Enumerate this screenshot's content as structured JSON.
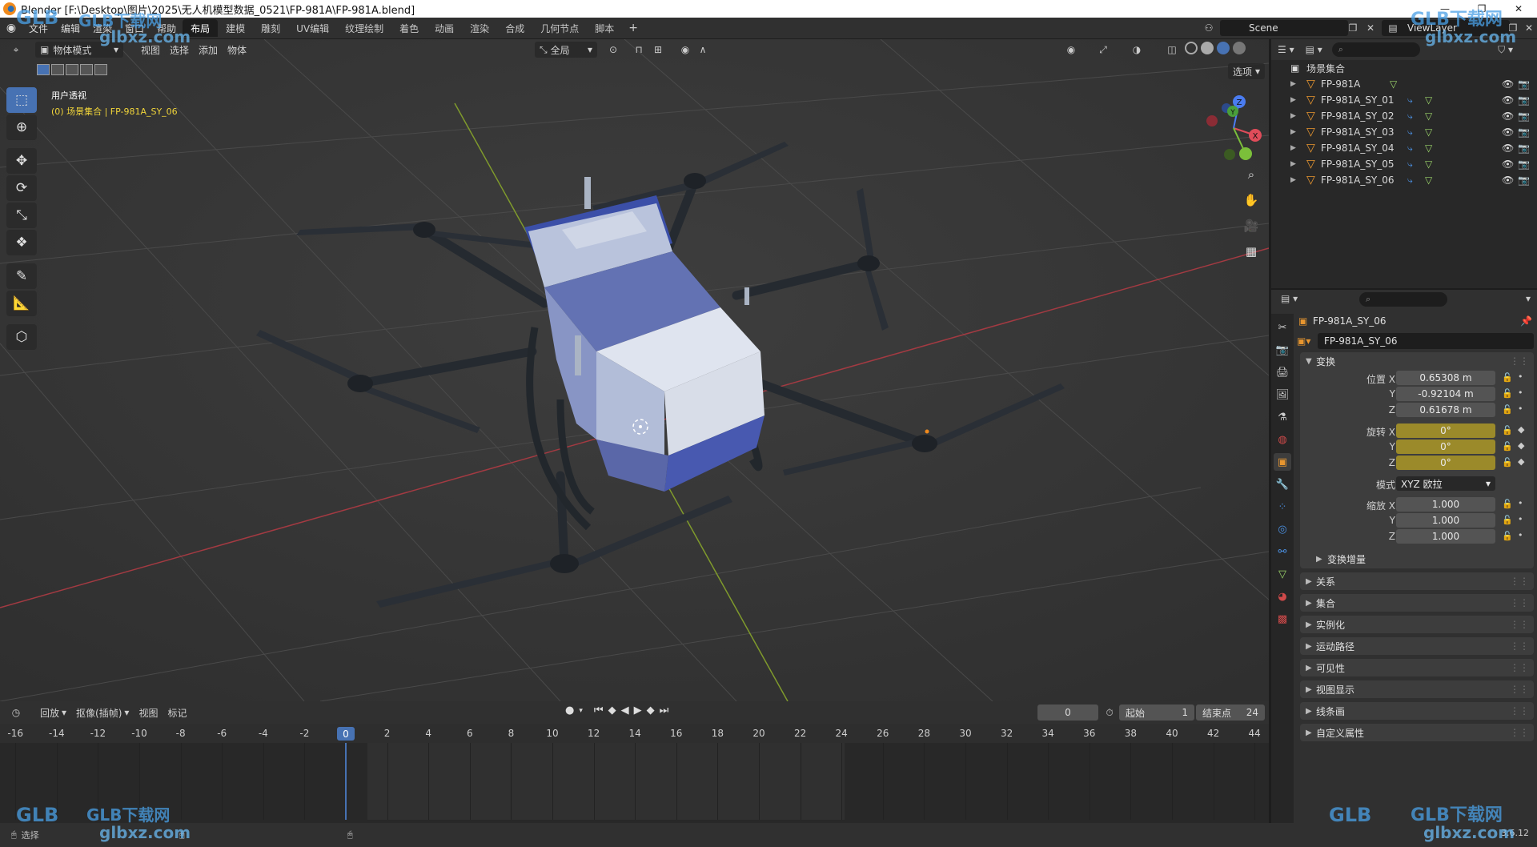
{
  "window": {
    "title": "Blender [F:\\Desktop\\图片\\2025\\无人机模型数据_0521\\FP-981A\\FP-981A.blend]",
    "controls": [
      "—",
      "❐",
      "✕"
    ]
  },
  "menubar": {
    "menus": [
      "文件",
      "编辑",
      "渲染",
      "窗口",
      "帮助"
    ],
    "workspaces": [
      "布局",
      "建模",
      "雕刻",
      "UV编辑",
      "纹理绘制",
      "着色",
      "动画",
      "渲染",
      "合成",
      "几何节点",
      "脚本"
    ],
    "active_workspace": "布局",
    "add_tab": "+",
    "scene": "Scene",
    "view_layer": "ViewLayer"
  },
  "viewport": {
    "mode": "物体模式",
    "menus": [
      "视图",
      "选择",
      "添加",
      "物体"
    ],
    "transform_orientation": "全局",
    "options_label": "选项",
    "view_name": "用户透视",
    "collection_info": "(0) 场景集合 | FP-981A_SY_06",
    "gizmo_axes": [
      "X",
      "Y",
      "Z"
    ]
  },
  "toolbar": {
    "tools": [
      "select-box-icon",
      "cursor-icon",
      "move-icon",
      "rotate-icon",
      "scale-icon",
      "transform-icon",
      "annotate-icon",
      "measure-icon",
      "add-cube-icon"
    ]
  },
  "timeline": {
    "menus": [
      "回放",
      "抠像(插帧)",
      "视图",
      "标记"
    ],
    "current_frame": "0",
    "start_label": "起始",
    "start_value": "1",
    "end_label": "结束点",
    "end_value": "24",
    "ticks": [
      "-16",
      "-14",
      "-12",
      "-10",
      "-8",
      "-6",
      "-4",
      "-2",
      "0",
      "2",
      "4",
      "6",
      "8",
      "10",
      "12",
      "14",
      "16",
      "18",
      "20",
      "22",
      "24",
      "26",
      "28",
      "30",
      "32",
      "34",
      "36",
      "38",
      "40",
      "42",
      "44"
    ],
    "playhead_label": "0"
  },
  "statusbar": {
    "left_text": "选择",
    "version": "3.6.12"
  },
  "outliner": {
    "root": "场景集合",
    "items": [
      {
        "name": "FP-981A",
        "has_modifier": false
      },
      {
        "name": "FP-981A_SY_01",
        "has_modifier": true
      },
      {
        "name": "FP-981A_SY_02",
        "has_modifier": true
      },
      {
        "name": "FP-981A_SY_03",
        "has_modifier": true
      },
      {
        "name": "FP-981A_SY_04",
        "has_modifier": true
      },
      {
        "name": "FP-981A_SY_05",
        "has_modifier": true
      },
      {
        "name": "FP-981A_SY_06",
        "has_modifier": true
      }
    ]
  },
  "properties": {
    "object_title": "FP-981A_SY_06",
    "object_name_field": "FP-981A_SY_06",
    "transform": {
      "header": "变换",
      "location_label": "位置 X",
      "location": [
        "0.65308 m",
        "-0.92104 m",
        "0.61678 m"
      ],
      "rotation_label": "旋转 X",
      "rotation": [
        "0°",
        "0°",
        "0°"
      ],
      "mode_label": "模式",
      "mode_value": "XYZ 欧拉",
      "scale_label": "缩放 X",
      "scale": [
        "1.000",
        "1.000",
        "1.000"
      ],
      "axis_y": "Y",
      "axis_z": "Z",
      "delta": "变换增量"
    },
    "closed_panels": [
      "关系",
      "集合",
      "实例化",
      "运动路径",
      "可见性",
      "视图显示",
      "线条画",
      "自定义属性"
    ]
  },
  "watermarks": [
    "GLB下载网",
    "glbxz.com"
  ],
  "colors": {
    "accent": "#4772b3",
    "object_orange": "#e8962f",
    "modifier_green": "#9bd46a",
    "rotation_field": "#9b8a2a",
    "status_yellow": "#f0d43a"
  }
}
